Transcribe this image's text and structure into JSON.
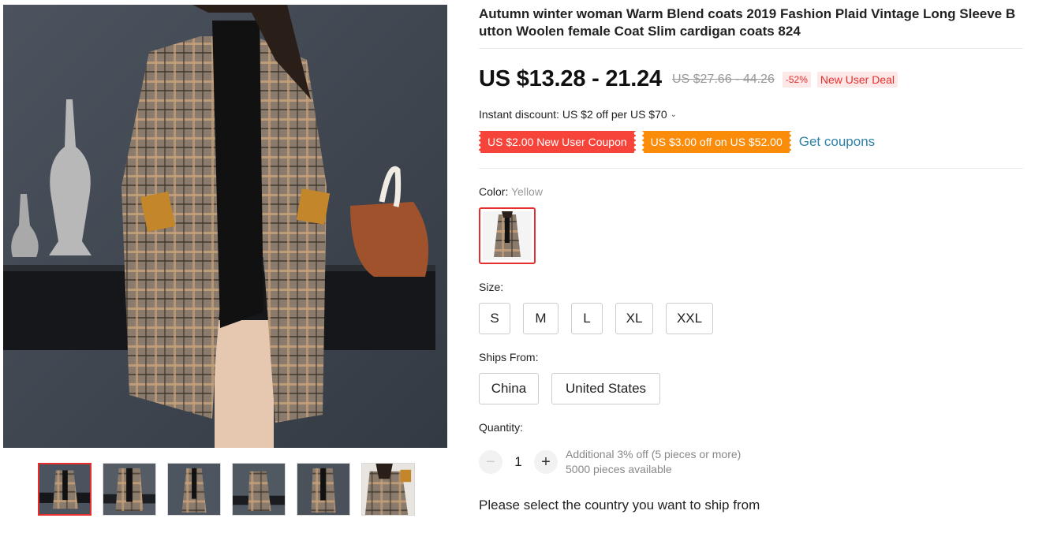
{
  "gallery": {
    "thumbnails": [
      {
        "alt": "Product image 1",
        "active": true
      },
      {
        "alt": "Product image 2",
        "active": false
      },
      {
        "alt": "Product image 3",
        "active": false
      },
      {
        "alt": "Product image 4",
        "active": false
      },
      {
        "alt": "Product image 5",
        "active": false
      },
      {
        "alt": "Product image 6",
        "active": false
      }
    ]
  },
  "product": {
    "title": "Autumn winter woman Warm Blend coats 2019 Fashion Plaid Vintage Long Sleeve Button Woolen female Coat Slim cardigan coats 824",
    "price_current": "US $13.28 - 21.24",
    "price_original": "US $27.66 - 44.26",
    "discount": "-52%",
    "deal_tag": "New User Deal",
    "instant_discount": "Instant discount: US $2 off per US $70"
  },
  "coupons": {
    "items": [
      "US $2.00 New User Coupon",
      "US $3.00 off on US $52.00"
    ],
    "get_label": "Get coupons"
  },
  "color": {
    "label": "Color:",
    "selected": "Yellow"
  },
  "size": {
    "label": "Size:",
    "options": [
      "S",
      "M",
      "L",
      "XL",
      "XXL"
    ]
  },
  "ships_from": {
    "label": "Ships From:",
    "options": [
      "China",
      "United States"
    ]
  },
  "quantity": {
    "label": "Quantity:",
    "minus": "−",
    "plus": "+",
    "value": "1",
    "note": "Additional 3% off (5 pieces or more)",
    "available": "5000 pieces available"
  },
  "ship_message": "Please select the country you want to ship from",
  "colors": {
    "accent_red": "#e62e2e",
    "coupon_red": "#f6443b",
    "coupon_orange": "#fa8c0a",
    "link_blue": "#2e82a5"
  }
}
